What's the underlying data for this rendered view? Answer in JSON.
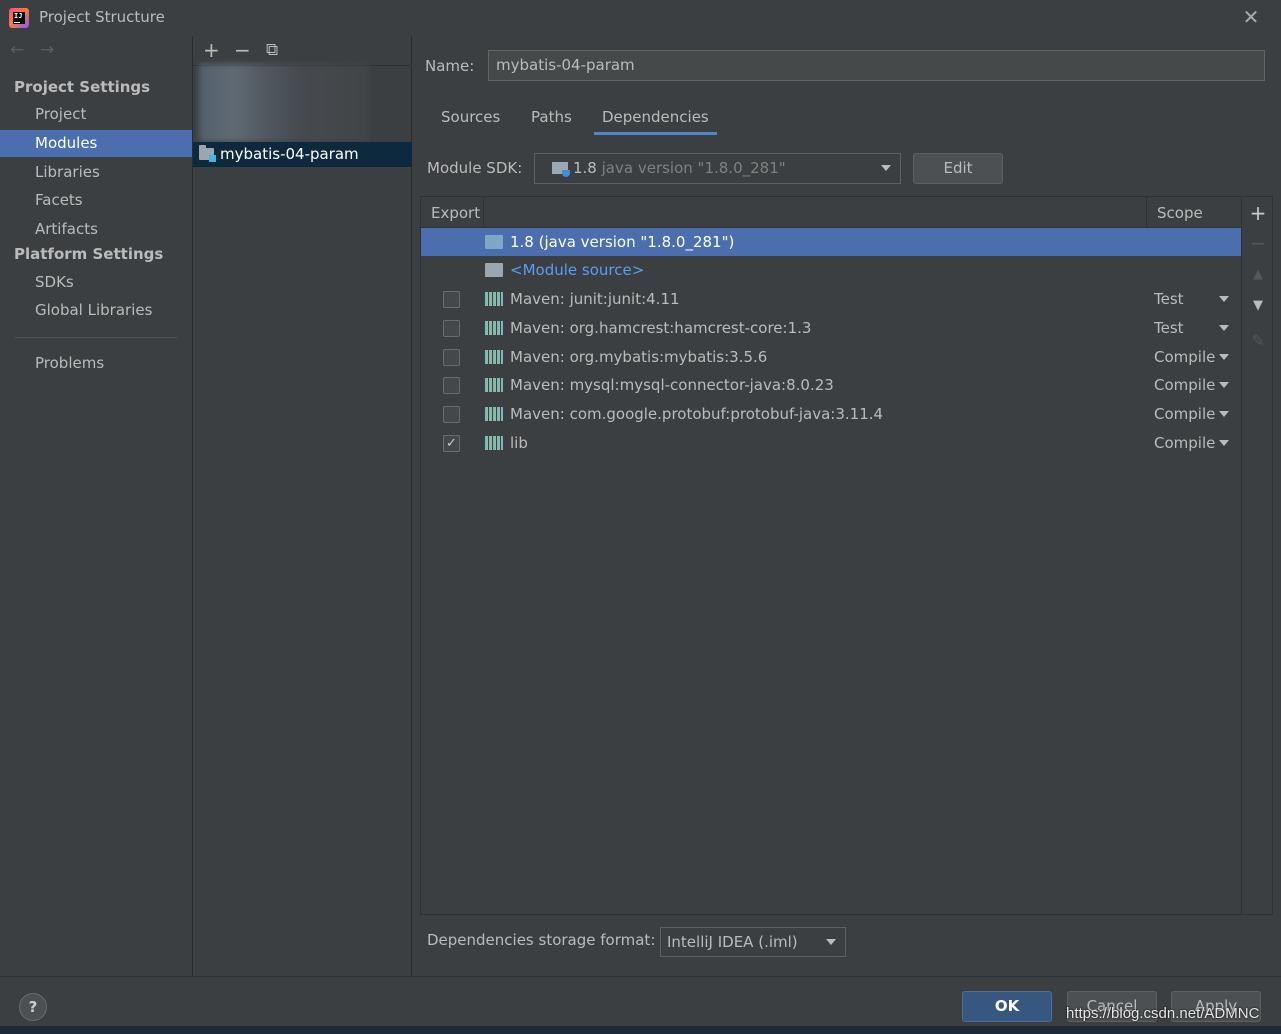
{
  "window": {
    "title": "Project Structure",
    "close_icon": "close-icon"
  },
  "nav": {
    "project_settings": "Project Settings",
    "project_items": [
      "Project",
      "Modules",
      "Libraries",
      "Facets",
      "Artifacts"
    ],
    "platform_settings": "Platform Settings",
    "platform_items": [
      "SDKs",
      "Global Libraries"
    ],
    "problems": "Problems",
    "selected": "Modules"
  },
  "modules": {
    "toolbar": {
      "add": "+",
      "remove": "−",
      "copy": "⧉"
    },
    "items": [
      "mybatis-04-param"
    ]
  },
  "module": {
    "name_label": "Name:",
    "name_value": "mybatis-04-param",
    "tabs": [
      "Sources",
      "Paths",
      "Dependencies"
    ],
    "active_tab": "Dependencies",
    "sdk_label": "Module SDK:",
    "sdk_version": "1.8",
    "sdk_detail": "java version \"1.8.0_281\"",
    "edit_button": "Edit"
  },
  "dependencies": {
    "col_export": "Export",
    "col_scope": "Scope",
    "rows": [
      {
        "name": "1.8 (java version \"1.8.0_281\")",
        "type": "sdk",
        "scope": "",
        "checked": null,
        "selected": true
      },
      {
        "name": "<Module source>",
        "type": "source",
        "scope": "",
        "checked": null,
        "selected": false
      },
      {
        "name": "Maven: junit:junit:4.11",
        "type": "maven",
        "scope": "Test",
        "checked": false
      },
      {
        "name": "Maven: org.hamcrest:hamcrest-core:1.3",
        "type": "maven",
        "scope": "Test",
        "checked": false
      },
      {
        "name": "Maven: org.mybatis:mybatis:3.5.6",
        "type": "maven",
        "scope": "Compile",
        "checked": false
      },
      {
        "name": "Maven: mysql:mysql-connector-java:8.0.23",
        "type": "maven",
        "scope": "Compile",
        "checked": false
      },
      {
        "name": "Maven: com.google.protobuf:protobuf-java:3.11.4",
        "type": "maven",
        "scope": "Compile",
        "checked": false
      },
      {
        "name": "lib",
        "type": "maven",
        "scope": "Compile",
        "checked": true
      }
    ],
    "side_tools": {
      "add": "+",
      "remove": "−",
      "up": "▲",
      "down": "▼",
      "edit": "✎"
    },
    "storage_label": "Dependencies storage format:",
    "storage_value": "IntelliJ IDEA (.iml)"
  },
  "footer": {
    "help": "?",
    "ok": "OK",
    "cancel": "Cancel",
    "apply": "Apply",
    "watermark": "https://blog.csdn.net/ADMNC"
  },
  "colors": {
    "background": "#3c3f41",
    "selection": "#4b6eaf",
    "module_selected": "#0d293e",
    "link": "#589df6",
    "ok_button": "#365880"
  }
}
